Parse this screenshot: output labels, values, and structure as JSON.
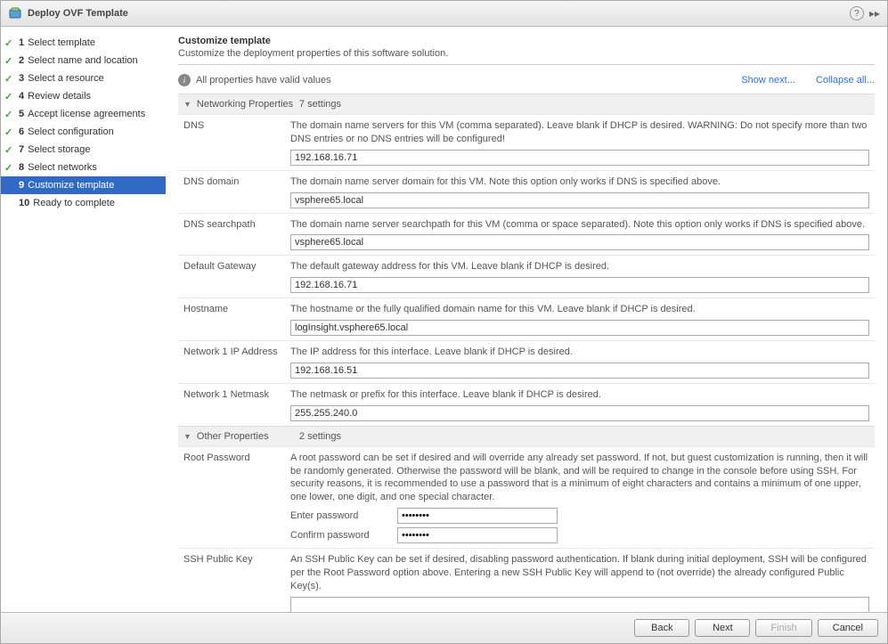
{
  "title": "Deploy OVF Template",
  "sidebar": [
    {
      "num": "1",
      "label": "Select template",
      "done": true
    },
    {
      "num": "2",
      "label": "Select name and location",
      "done": true
    },
    {
      "num": "3",
      "label": "Select a resource",
      "done": true
    },
    {
      "num": "4",
      "label": "Review details",
      "done": true
    },
    {
      "num": "5",
      "label": "Accept license agreements",
      "done": true
    },
    {
      "num": "6",
      "label": "Select configuration",
      "done": true
    },
    {
      "num": "7",
      "label": "Select storage",
      "done": true
    },
    {
      "num": "8",
      "label": "Select networks",
      "done": true
    },
    {
      "num": "9",
      "label": "Customize template",
      "done": false,
      "active": true
    },
    {
      "num": "10",
      "label": "Ready to complete",
      "done": false
    }
  ],
  "header": {
    "title": "Customize template",
    "subtitle": "Customize the deployment properties of this software solution."
  },
  "status": {
    "text": "All properties have valid values",
    "show_next": "Show next...",
    "collapse": "Collapse all..."
  },
  "sections": [
    {
      "title": "Networking Properties",
      "count": "7 settings"
    },
    {
      "title": "Other Properties",
      "count": "2 settings"
    }
  ],
  "props": {
    "dns": {
      "label": "DNS",
      "desc": "The domain name servers for this VM (comma separated). Leave blank if DHCP is desired. WARNING: Do not specify more than two DNS entries or no DNS entries will be configured!",
      "value": "192.168.16.71"
    },
    "dnsdomain": {
      "label": "DNS domain",
      "desc": "The domain name server domain for this VM. Note this option only works if DNS is specified above.",
      "value": "vsphere65.local"
    },
    "dnssearch": {
      "label": "DNS searchpath",
      "desc": "The domain name server searchpath for this VM (comma or space separated). Note this option only works if DNS is specified above.",
      "value": "vsphere65.local"
    },
    "gateway": {
      "label": "Default Gateway",
      "desc": "The default gateway address for this VM. Leave blank if DHCP is desired.",
      "value": "192.168.16.71"
    },
    "hostname": {
      "label": "Hostname",
      "desc": "The hostname or the fully qualified domain name for this VM. Leave blank if DHCP is desired.",
      "value": "logInsight.vsphere65.local"
    },
    "ip": {
      "label": "Network 1 IP Address",
      "desc": "The IP address for this interface. Leave blank if DHCP is desired.",
      "value": "192.168.16.51"
    },
    "netmask": {
      "label": "Network 1 Netmask",
      "desc": "The netmask or prefix for this interface. Leave blank if DHCP is desired.",
      "value": "255.255.240.0"
    },
    "rootpw": {
      "label": "Root Password",
      "desc": "A root password can be set if desired and will override any already set password. If not, but guest customization is running, then it will be randomly generated. Otherwise the password will be blank, and will be required to change in the console before using SSH. For security reasons, it is recommended to use a password that is a minimum of eight characters and contains a minimum of one upper, one lower, one digit, and one special character.",
      "enter": "Enter password",
      "confirm": "Confirm password",
      "value": "••••••••"
    },
    "sshkey": {
      "label": "SSH Public Key",
      "desc": "An SSH Public Key can be set if desired, disabling password authentication. If blank during initial deployment, SSH will be configured per the Root Password option above. Entering a new SSH Public Key will append to (not override) the already configured Public Key(s).",
      "value": ""
    }
  },
  "footer": {
    "back": "Back",
    "next": "Next",
    "finish": "Finish",
    "cancel": "Cancel"
  }
}
